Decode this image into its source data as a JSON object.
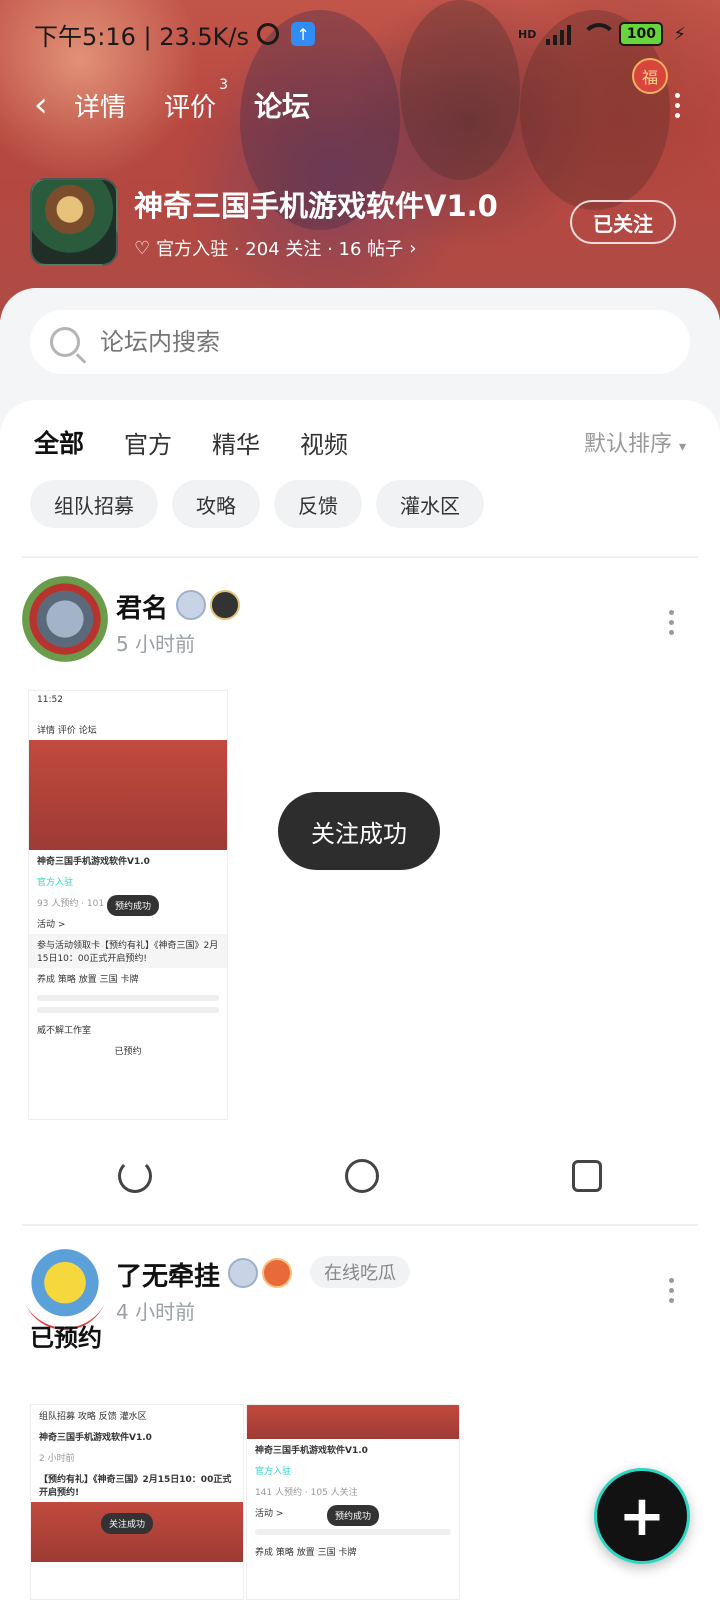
{
  "status_bar": {
    "time": "下午5:16 | 23.5K/s",
    "battery": "100",
    "network": "HD"
  },
  "nav": {
    "tabs": [
      {
        "label": "详情"
      },
      {
        "label": "评价",
        "count": "3"
      },
      {
        "label": "论坛"
      }
    ],
    "fu": "福"
  },
  "app": {
    "name": "神奇三国手机游戏软件V1.0",
    "meta": "官方入驻 · 204 关注 · 16 帖子",
    "follow_label": "已关注"
  },
  "search": {
    "placeholder": "论坛内搜索"
  },
  "filter_tabs": [
    "全部",
    "官方",
    "精华",
    "视频"
  ],
  "sort_label": "默认排序",
  "chips": [
    "组队招募",
    "攻略",
    "反馈",
    "灌水区"
  ],
  "posts": [
    {
      "username": "君名",
      "time": "5 小时前"
    },
    {
      "username": "了无牵挂",
      "time": "4 小时前",
      "status": "在线吃瓜",
      "text": "已预约"
    }
  ],
  "toast": "关注成功",
  "shot1": {
    "time": "11:52",
    "tabs": "详情  评价  论坛",
    "app_name": "神奇三国手机游戏软件V1.0",
    "official": "官方入驻",
    "counts": "93 人预约 · 101 人关注",
    "activity": "活动 >",
    "toast": "预约成功",
    "event_text": "参与活动领取卡【预约有礼】《神奇三国》2月15日10：00正式开启预约!",
    "tags": "养成  策略  放置  三国  卡牌",
    "bottom": "已预约",
    "studio": "威不解工作室"
  },
  "shot2": {
    "app_name": "神奇三国手机游戏软件V1.0",
    "time": "2 小时前",
    "title": "【预约有礼】《神奇三国》2月15日10：00正式开启预约!",
    "toast": "关注成功",
    "chips": "组队招募  攻略  反馈  灌水区"
  },
  "shot3": {
    "app_name": "神奇三国手机游戏软件V1.0",
    "official": "官方入驻",
    "counts": "141 人预约 · 105 人关注",
    "activity": "活动 >",
    "toast": "预约成功",
    "tags": "养成  策略  放置  三国  卡牌"
  },
  "colors": {
    "accent": "#2bd6c3",
    "banner": "#b7473f"
  }
}
